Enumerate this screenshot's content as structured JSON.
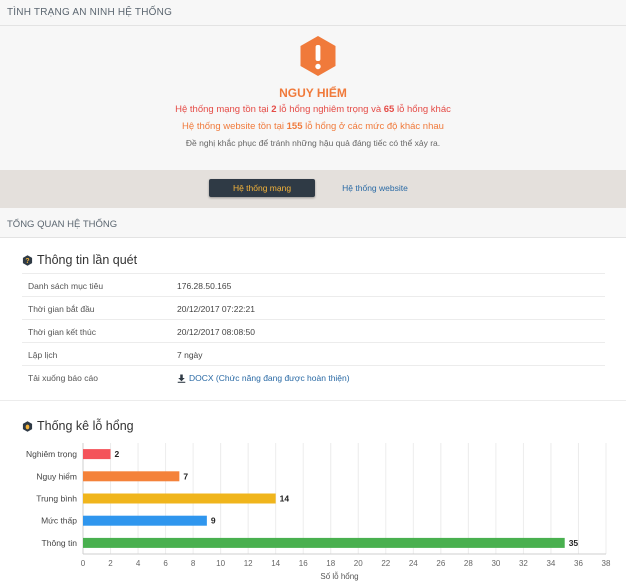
{
  "header": {
    "title": "TÌNH TRẠNG AN NINH HỆ THỐNG"
  },
  "alert": {
    "title": "NGUY HIỂM",
    "line1_pre": "Hệ thống mạng tồn tại ",
    "line1_n1": "2",
    "line1_mid": " lỗ hổng nghiêm trọng và ",
    "line1_n2": "65",
    "line1_post": " lỗ hổng khác",
    "line2_pre": "Hệ thống website tồn tại ",
    "line2_n1": "155",
    "line2_post": " lỗ hổng ở các mức độ khác nhau",
    "line3": "Đề nghị khắc phục để tránh những hậu quả đáng tiếc có thể xảy ra.",
    "icon": "warning-hexagon-icon",
    "color": "#f07a3b"
  },
  "tabs": [
    {
      "label": "Hệ thống mạng",
      "active": true
    },
    {
      "label": "Hệ thống website",
      "active": false
    }
  ],
  "overview": {
    "title": "TỔNG QUAN HỆ THỐNG"
  },
  "scan_info": {
    "title": "Thông tin lần quét",
    "rows": [
      {
        "key": "Danh sách mục tiêu",
        "value": "176.28.50.165"
      },
      {
        "key": "Thời gian bắt đầu",
        "value": "20/12/2017 07:22:21"
      },
      {
        "key": "Thời gian kết thúc",
        "value": "20/12/2017 08:08:50"
      },
      {
        "key": "Lập lịch",
        "value": "7 ngày"
      },
      {
        "key": "Tải xuống báo cáo",
        "value": "DOCX (Chức năng đang được hoàn thiện)"
      }
    ]
  },
  "stats": {
    "title": "Thống kê lỗ hổng"
  },
  "chart_data": {
    "type": "bar",
    "orientation": "horizontal",
    "categories": [
      "Nghiêm trọng",
      "Nguy hiểm",
      "Trung bình",
      "Mức thấp",
      "Thông tin"
    ],
    "values": [
      2,
      7,
      14,
      9,
      35
    ],
    "colors": [
      "#f4535a",
      "#f4823a",
      "#f0b51c",
      "#2f96ee",
      "#49b04f"
    ],
    "xlabel": "Số lỗ hổng",
    "ylabel": "",
    "xlim": [
      0,
      38
    ],
    "xticks": [
      0,
      2,
      4,
      6,
      8,
      10,
      12,
      14,
      16,
      18,
      20,
      22,
      24,
      26,
      28,
      30,
      32,
      34,
      36,
      38
    ],
    "grid": true,
    "legend": "none"
  }
}
